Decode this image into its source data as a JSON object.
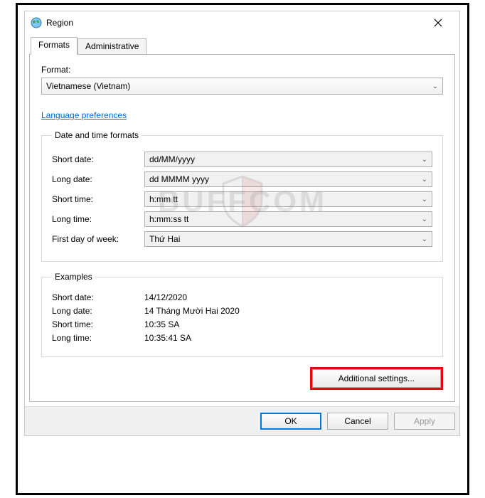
{
  "window": {
    "title": "Region"
  },
  "tabs": {
    "formats": "Formats",
    "administrative": "Administrative"
  },
  "format_section": {
    "label": "Format:",
    "selected": "Vietnamese (Vietnam)"
  },
  "links": {
    "language_preferences": "Language preferences"
  },
  "date_time_group": {
    "legend": "Date and time formats",
    "short_date_label": "Short date:",
    "short_date_value": "dd/MM/yyyy",
    "long_date_label": "Long date:",
    "long_date_value": "dd MMMM yyyy",
    "short_time_label": "Short time:",
    "short_time_value": "h:mm tt",
    "long_time_label": "Long time:",
    "long_time_value": "h:mm:ss tt",
    "first_day_label": "First day of week:",
    "first_day_value": "Thứ Hai"
  },
  "examples_group": {
    "legend": "Examples",
    "short_date_label": "Short date:",
    "short_date_value": "14/12/2020",
    "long_date_label": "Long date:",
    "long_date_value": "14 Tháng Mười Hai 2020",
    "short_time_label": "Short time:",
    "short_time_value": "10:35 SA",
    "long_time_label": "Long time:",
    "long_time_value": "10:35:41 SA"
  },
  "buttons": {
    "additional_settings": "Additional settings...",
    "ok": "OK",
    "cancel": "Cancel",
    "apply": "Apply"
  },
  "watermark": "BUFFCOM"
}
